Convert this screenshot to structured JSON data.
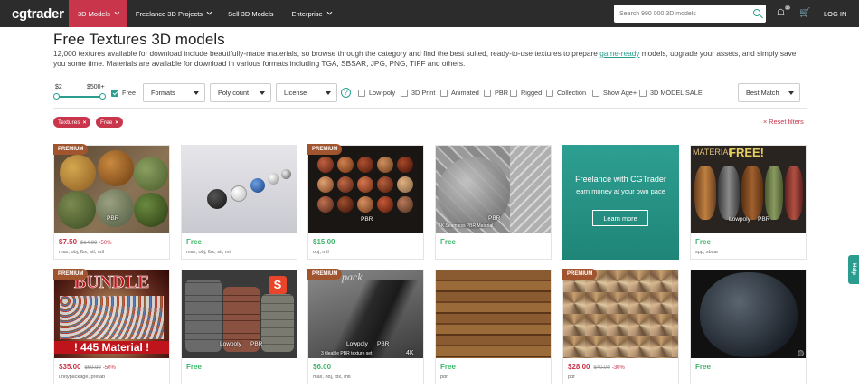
{
  "nav": {
    "logo": "cgtrader",
    "items": [
      {
        "label": "3D Models"
      },
      {
        "label": "Freelance 3D Projects"
      },
      {
        "label": "Sell 3D Models"
      },
      {
        "label": "Enterprise"
      }
    ],
    "search_placeholder": "Search 990 000 3D models",
    "badge": "20",
    "login": "LOG IN"
  },
  "page": {
    "title": "Free Textures 3D models",
    "desc_before": "12,000 textures available for download include beautifully-made materials, so browse through the category and find the best suited, ready-to-use textures to prepare ",
    "desc_link": "game-ready",
    "desc_after": " models, upgrade your assets, and simply save you some time. Materials are available for download in various formats including TGA, SBSAR, JPG, PNG, TIFF and others."
  },
  "filters": {
    "price_min": "$2",
    "price_max": "$500+",
    "free_label": "Free",
    "formats": "Formats",
    "poly_count": "Poly count",
    "license": "License",
    "help": "?",
    "checks": [
      "Low-poly",
      "3D Print",
      "Animated",
      "PBR",
      "Rigged",
      "Collection",
      "Show Age+",
      "3D MODEL SALE"
    ],
    "sort": "Best Match"
  },
  "active_tags": [
    "Textures",
    "Free"
  ],
  "reset_filters": "Reset filters",
  "premium_label": "PREMIUM",
  "cards": [
    {
      "price": "$7.50",
      "old": "$14.99",
      "off": "-50%",
      "formats": "max, obj, fbx, stl, mtl",
      "labels": [
        "PBR"
      ]
    },
    {
      "price": "Free",
      "formats": "max, obj, fbx, stl, mtl",
      "labels": []
    },
    {
      "price": "$15.00",
      "formats": "obj, mtl",
      "labels": [
        "PBR"
      ]
    },
    {
      "price": "Free",
      "formats": "",
      "labels": [
        "PBR",
        "4K Seamless PBR Material"
      ]
    },
    {
      "price": "",
      "formats": "",
      "labels": [],
      "ad": {
        "title": "Freelance with CGTrader",
        "sub": "earn money at your own pace",
        "button": "Learn more"
      }
    },
    {
      "price": "Free",
      "formats": "spp, sbsar",
      "labels": [
        "Lowpoly",
        "PBR",
        "MATERIAL",
        "FREE!"
      ]
    },
    {
      "price": "$35.00",
      "old": "$69.99",
      "off": "-50%",
      "formats": "unitypackage, prefab",
      "labels": [
        "BUNDLE",
        "! 445 Material !"
      ]
    },
    {
      "price": "Free",
      "formats": "",
      "labels": [
        "Lowpoly",
        "PBR"
      ]
    },
    {
      "price": "$6.00",
      "formats": "max, obj, fbx, mtl",
      "labels": [
        "Lowpoly",
        "PBR",
        "3 tileable PBR texture set",
        "4K",
        "d pack"
      ]
    },
    {
      "price": "Free",
      "formats": "pdf",
      "labels": []
    },
    {
      "price": "$28.00",
      "old": "$40.00",
      "off": "-30%",
      "formats": "pdf",
      "labels": []
    },
    {
      "price": "Free",
      "formats": "",
      "labels": []
    }
  ],
  "help_tab": "Help",
  "colors": {
    "accent": "#2a9d8f",
    "brand_red": "#c9354a",
    "premium": "#a1552f",
    "nav_bg": "#2c2c2c"
  }
}
